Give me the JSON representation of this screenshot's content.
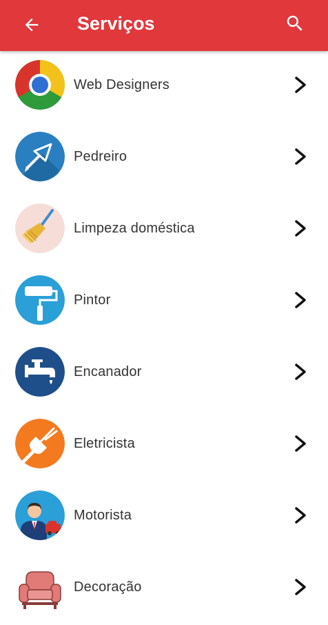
{
  "appbar": {
    "title": "Serviços",
    "back_icon": "arrow-back-icon",
    "search_icon": "search-icon",
    "color": "#e0383b"
  },
  "services": [
    {
      "label": "Web Designers",
      "icon": "chrome-logo-icon"
    },
    {
      "label": "Pedreiro",
      "icon": "trowel-icon"
    },
    {
      "label": "Limpeza doméstica",
      "icon": "broom-icon"
    },
    {
      "label": "Pintor",
      "icon": "paint-roller-icon"
    },
    {
      "label": "Encanador",
      "icon": "faucet-icon"
    },
    {
      "label": "Eletricista",
      "icon": "electric-plug-icon"
    },
    {
      "label": "Motorista",
      "icon": "driver-icon"
    },
    {
      "label": "Decoração",
      "icon": "armchair-icon"
    }
  ]
}
